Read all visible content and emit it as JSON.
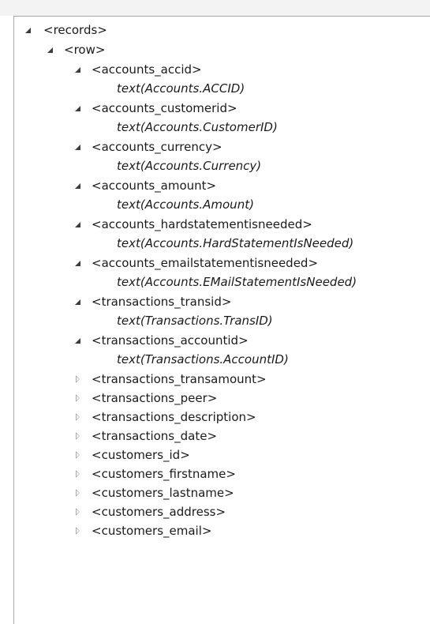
{
  "tree": {
    "root": {
      "label": "<records>",
      "row": {
        "label": "<row>",
        "children": [
          {
            "label": "<accounts_accid>",
            "value": "text(Accounts.ACCID)"
          },
          {
            "label": "<accounts_customerid>",
            "value": "text(Accounts.CustomerID)"
          },
          {
            "label": "<accounts_currency>",
            "value": "text(Accounts.Currency)"
          },
          {
            "label": "<accounts_amount>",
            "value": "text(Accounts.Amount)"
          },
          {
            "label": "<accounts_hardstatementisneeded>",
            "value": "text(Accounts.HardStatementIsNeeded)"
          },
          {
            "label": "<accounts_emailstatementisneeded>",
            "value": "text(Accounts.EMailStatementIsNeeded)"
          },
          {
            "label": "<transactions_transid>",
            "value": "text(Transactions.TransID)"
          },
          {
            "label": "<transactions_accountid>",
            "value": "text(Transactions.AccountID)"
          },
          {
            "label": "<transactions_transamount>"
          },
          {
            "label": "<transactions_peer>"
          },
          {
            "label": "<transactions_description>"
          },
          {
            "label": "<transactions_date>"
          },
          {
            "label": "<customers_id>"
          },
          {
            "label": "<customers_firstname>"
          },
          {
            "label": "<customers_lastname>"
          },
          {
            "label": "<customers_address>"
          },
          {
            "label": "<customers_email>"
          }
        ]
      }
    }
  }
}
